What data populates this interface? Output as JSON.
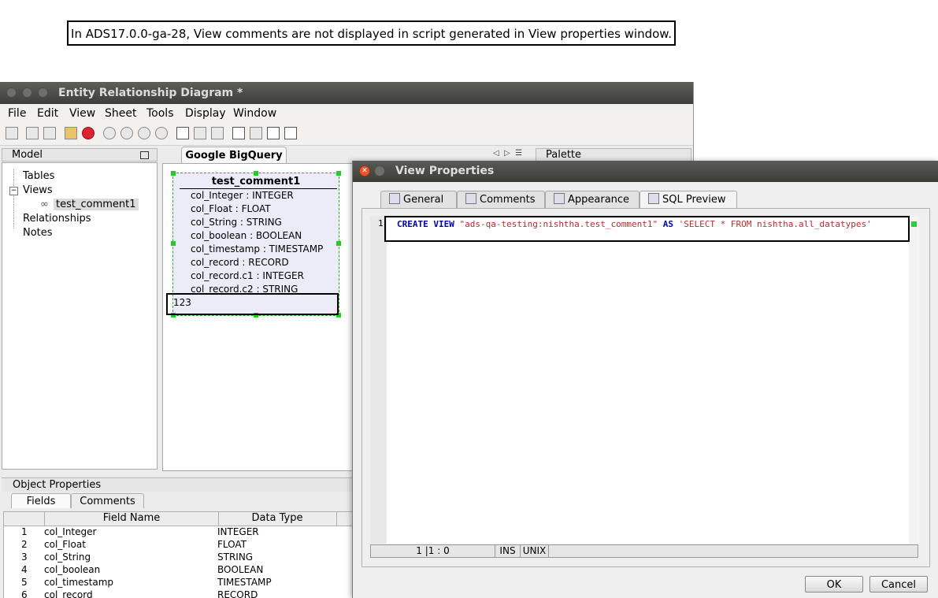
{
  "annotation": "In ADS17.0.0-ga-28, View comments are not displayed in script generated in View properties window.",
  "erd_window": {
    "title": "Entity Relationship Diagram *",
    "menu": [
      "File",
      "Edit",
      "View",
      "Sheet",
      "Tools",
      "Display",
      "Window"
    ]
  },
  "model_panel": {
    "title": "Model",
    "tree": {
      "tables": "Tables",
      "views": "Views",
      "view_item": "test_comment1",
      "relationships": "Relationships",
      "notes": "Notes"
    }
  },
  "diagram": {
    "tab": "Google BigQuery",
    "entity": {
      "title": "test_comment1",
      "fields": [
        "col_Integer : INTEGER",
        "col_Float : FLOAT",
        "col_String : STRING",
        "col_boolean : BOOLEAN",
        "col_timestamp : TIMESTAMP",
        "col_record : RECORD",
        "col_record.c1 : INTEGER",
        "col_record.c2 : STRING"
      ],
      "comment": "123"
    }
  },
  "palette": {
    "title": "Palette"
  },
  "object_properties": {
    "title": "Object Properties",
    "tabs": [
      "Fields",
      "Comments"
    ],
    "columns": [
      "Field Name",
      "Data Type"
    ],
    "rows": [
      {
        "n": "1",
        "name": "col_Integer",
        "type": "INTEGER"
      },
      {
        "n": "2",
        "name": "col_Float",
        "type": "FLOAT"
      },
      {
        "n": "3",
        "name": "col_String",
        "type": "STRING"
      },
      {
        "n": "4",
        "name": "col_boolean",
        "type": "BOOLEAN"
      },
      {
        "n": "5",
        "name": "col_timestamp",
        "type": "TIMESTAMP"
      },
      {
        "n": "6",
        "name": "col_record",
        "type": "RECORD"
      }
    ]
  },
  "dialog": {
    "title": "View Properties",
    "tabs": [
      "General",
      "Comments",
      "Appearance",
      "SQL Preview"
    ],
    "active_tab": "SQL Preview",
    "line_number": "1",
    "sql": {
      "kw1": "CREATE VIEW",
      "str1": "\"ads-qa-testing:nishtha.test_comment1\"",
      "kw2": "AS",
      "str2": "'SELECT * FROM nishtha.all_datatypes'"
    },
    "status": {
      "position": "1 |1 : 0",
      "mode": "INS",
      "eol": "UNIX"
    },
    "ok_label": "OK",
    "cancel_label": "Cancel"
  }
}
